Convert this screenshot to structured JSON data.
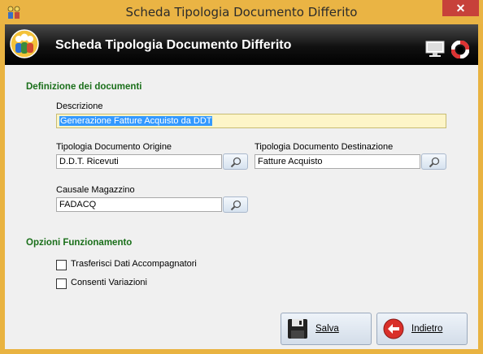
{
  "window": {
    "title": "Scheda Tipologia Documento Differito",
    "close_glyph": "✕"
  },
  "header": {
    "title": "Scheda Tipologia Documento Differito",
    "icons": [
      "users-logo-icon",
      "monitor-icon",
      "lifebuoy-icon"
    ]
  },
  "definizione": {
    "section_title": "Definizione dei documenti",
    "descrizione_label": "Descrizione",
    "descrizione_value": "Generazione Fatture Acquisto da DDT",
    "origine_label": "Tipologia Documento Origine",
    "origine_value": "D.D.T. Ricevuti",
    "destinazione_label": "Tipologia Documento Destinazione",
    "destinazione_value": "Fatture Acquisto",
    "causale_label": "Causale Magazzino",
    "causale_value": "FADACQ"
  },
  "opzioni": {
    "section_title": "Opzioni Funzionamento",
    "items": [
      {
        "label": "Trasferisci Dati Accompagnatori",
        "checked": false
      },
      {
        "label": "Consenti Variazioni",
        "checked": false
      }
    ]
  },
  "buttons": {
    "save_label": "Salva",
    "back_label": "Indietro"
  },
  "colors": {
    "title_bar": "#eab444",
    "section_title": "#1a6f1a",
    "focused_field": "#fdf5c8",
    "close_button": "#c7413a"
  }
}
